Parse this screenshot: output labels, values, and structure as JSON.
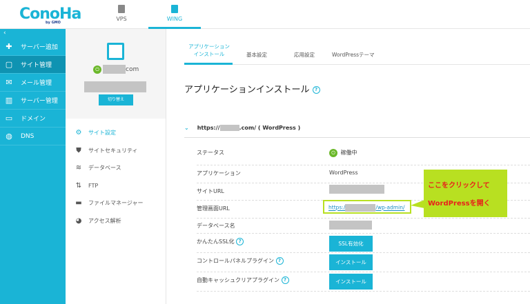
{
  "header": {
    "logo": "ConoHa",
    "logo_sub": "by GMO",
    "nav": [
      {
        "label": "VPS",
        "icon": "server-icon"
      },
      {
        "label": "WING",
        "icon": "wing-icon",
        "active": true
      }
    ]
  },
  "sidebar": {
    "collapse": "‹",
    "items": [
      {
        "label": "サーバー追加",
        "icon": "plus-icon"
      },
      {
        "label": "サイト管理",
        "icon": "window-icon",
        "selected": true
      },
      {
        "label": "メール管理",
        "icon": "mail-icon"
      },
      {
        "label": "サーバー管理",
        "icon": "server-icon"
      },
      {
        "label": "ドメイン",
        "icon": "domain-icon"
      },
      {
        "label": "DNS",
        "icon": "globe-icon"
      }
    ]
  },
  "site_panel": {
    "domain_suffix": "com",
    "switch_label": "切り替え",
    "menu": [
      {
        "label": "サイト設定",
        "icon": "site-settings-icon",
        "selected": true
      },
      {
        "label": "サイトセキュリティ",
        "icon": "shield-icon"
      },
      {
        "label": "データベース",
        "icon": "database-icon"
      },
      {
        "label": "FTP",
        "icon": "ftp-icon"
      },
      {
        "label": "ファイルマネージャー",
        "icon": "folder-icon"
      },
      {
        "label": "アクセス解析",
        "icon": "pie-chart-icon"
      }
    ]
  },
  "tabs": [
    {
      "label": "アプリケーション\nインストール",
      "active": true
    },
    {
      "label": "基本設定"
    },
    {
      "label": "応用設定"
    },
    {
      "label": "WordPressテーマ"
    }
  ],
  "main": {
    "title": "アプリケーションインストール",
    "help": "?",
    "accordion_prefix": "https://",
    "accordion_suffix": ".com/ ( WordPress )",
    "rows": [
      {
        "label": "ステータス",
        "value": "稼働中"
      },
      {
        "label": "アプリケーション",
        "value": "WordPress"
      },
      {
        "label": "サイトURL"
      },
      {
        "label": "管理画面URL",
        "link_prefix": "https:/",
        "link_suffix": "/wp-admin/"
      },
      {
        "label": "データベース名"
      },
      {
        "label": "かんたんSSL化",
        "button": "SSL有効化"
      },
      {
        "label": "コントロールパネルプラグイン",
        "button": "インストール"
      },
      {
        "label": "自動キャッシュクリアプラグイン",
        "button": "インストール"
      }
    ]
  },
  "callout": {
    "line1": "ここをクリックして",
    "line2": "WordPressを開く"
  },
  "colors": {
    "accent": "#1ab4d6",
    "sidebar_selected": "#0f93b2",
    "callout_bg": "#b8e021",
    "callout_text": "#e8201a",
    "status_green": "#6bb82a"
  }
}
